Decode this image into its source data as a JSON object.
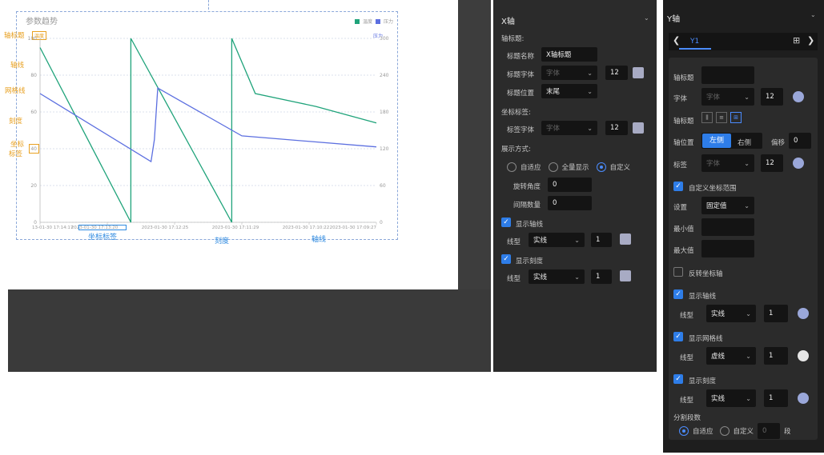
{
  "canvas": {
    "chart_title": "参数趋势",
    "legend": [
      {
        "name": "温度",
        "color": "#1fa37a"
      },
      {
        "name": "压力",
        "color": "#5c6fe0"
      }
    ],
    "y_axis_tag": "温度",
    "y2_axis_tag": "压力"
  },
  "chart_data": {
    "type": "line",
    "x_ticks": [
      "13-01-30 17:14:17",
      "2023-01-30 17:13:20",
      "2023-01-30 17:12:25",
      "2023-01-30 17:11:29",
      "2023-01-30 17:10:22",
      "2023-01-30 17:09:27"
    ],
    "y_ticks": [
      "0",
      "20",
      "40",
      "60",
      "80",
      "100"
    ],
    "y2_ticks": [
      "0",
      "60",
      "120",
      "180",
      "240",
      "300"
    ],
    "ylim": [
      0,
      100
    ],
    "y2lim": [
      0,
      300
    ],
    "series": [
      {
        "name": "温度",
        "color": "#1fa37a",
        "points": [
          [
            0,
            95
          ],
          [
            0.27,
            0
          ],
          [
            0.27,
            100
          ],
          [
            0.57,
            0
          ],
          [
            0.57,
            100
          ],
          [
            0.64,
            70
          ],
          [
            0.82,
            63
          ],
          [
            1,
            54
          ]
        ]
      },
      {
        "name": "压力",
        "color": "#5c6fe0",
        "points": [
          [
            0,
            70
          ],
          [
            0.33,
            33
          ],
          [
            0.34,
            45
          ],
          [
            0.35,
            73
          ],
          [
            0.6,
            47
          ],
          [
            1,
            41
          ]
        ]
      }
    ]
  },
  "annotations": {
    "axis_title": "轴标题",
    "axis_line": "轴线",
    "grid_line": "网格线",
    "tick": "刻度",
    "tick_label_1": "坐标",
    "tick_label_2": "标签",
    "x_tick_label": "坐标标签",
    "x_tick": "刻度",
    "x_axis_line": "轴线"
  },
  "x_panel": {
    "title": "X轴",
    "axis_title_section": "轴标题:",
    "title_name_label": "标题名称",
    "title_name_value": "X轴标题",
    "title_font_label": "标题字体",
    "font_placeholder": "字体",
    "title_font_size": "12",
    "title_position_label": "标题位置",
    "title_position_value": "末尾",
    "tick_label_section": "坐标标签:",
    "label_font_label": "标签字体",
    "label_font_size": "12",
    "display_mode_label": "展示方式:",
    "mode_options": [
      "自适应",
      "全量显示",
      "自定义"
    ],
    "rotate_label": "旋转角度",
    "rotate_value": "0",
    "interval_label": "间隔数量",
    "interval_value": "0",
    "show_axis_line": "显示轴线",
    "line_type_label": "线型",
    "axis_line_type": "实线",
    "axis_line_width": "1",
    "show_tick": "显示刻度",
    "tick_line_type": "实线",
    "tick_line_width": "1"
  },
  "y_panel": {
    "title": "Y轴",
    "tab": "Y1",
    "axis_title_label": "轴标题",
    "font_label": "字体",
    "font_placeholder": "字体",
    "font_size": "12",
    "axis_title_style_label": "轴标题",
    "position_label": "轴位置",
    "pos_left": "左侧",
    "pos_right": "右侧",
    "offset_label": "偏移",
    "offset_value": "0",
    "tick_label": "标签",
    "label_font_size": "12",
    "custom_range": "自定义坐标范围",
    "setting_label": "设置",
    "setting_value": "固定值",
    "min_label": "最小值",
    "max_label": "最大值",
    "reverse": "反转坐标轴",
    "show_axis_line": "显示轴线",
    "axis_line_type_label": "线型",
    "axis_line_type": "实线",
    "axis_line_width": "1",
    "show_grid": "显示网格线",
    "grid_type_label": "线型",
    "grid_type": "虚线",
    "grid_width": "1",
    "show_tick": "显示刻度",
    "tick_type_label": "线型",
    "tick_type": "实线",
    "tick_width": "1",
    "segments_label": "分割段数",
    "seg_auto": "自适应",
    "seg_custom": "自定义",
    "seg_value": "0",
    "seg_unit": "段"
  }
}
